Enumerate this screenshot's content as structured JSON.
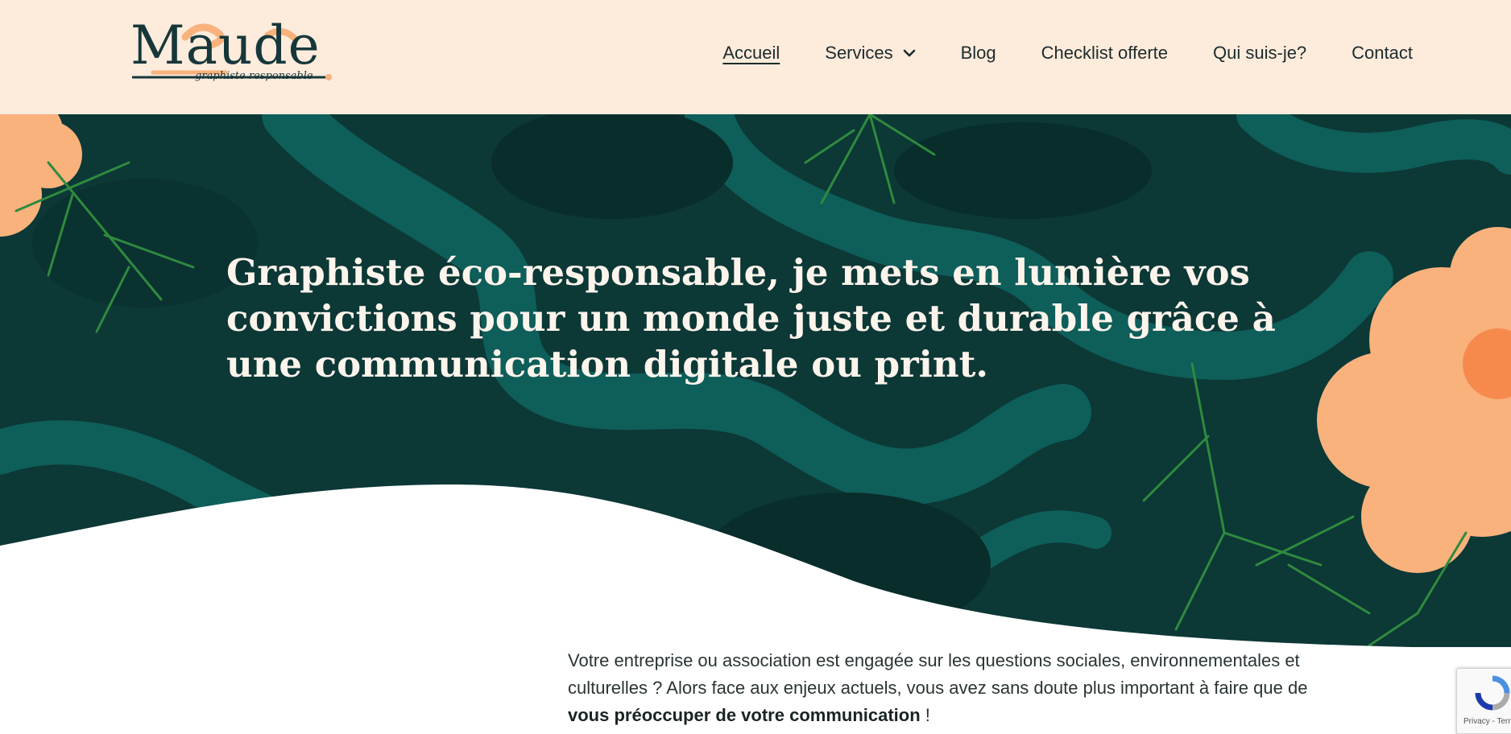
{
  "brand": {
    "name": "Maude",
    "tagline": "graphiste responsable"
  },
  "nav": {
    "items": [
      {
        "label": "Accueil",
        "active": true
      },
      {
        "label": "Services",
        "has_dropdown": true
      },
      {
        "label": "Blog"
      },
      {
        "label": "Checklist offerte"
      },
      {
        "label": "Qui suis-je?"
      },
      {
        "label": "Contact"
      }
    ]
  },
  "hero": {
    "title": "Graphiste éco-responsable, je mets en lumière vos convictions pour un monde juste et durable grâce à une communication digitale ou print."
  },
  "intro": {
    "text_before": "Votre entreprise ou association est engagée sur les questions sociales, environnementales et culturelles ? Alors face aux enjeux actuels, vous avez sans doute plus important à faire que de ",
    "text_bold": "vous préoccuper de votre communication",
    "text_after": " !"
  },
  "recaptcha": {
    "text": "Privacy - Terms"
  },
  "colors": {
    "header_bg": "#fdebdc",
    "hero_dark": "#0c3836",
    "hero_teal": "#0e5e5a",
    "flower_orange": "#f9b27c",
    "leaf_green": "#2f8a3e",
    "text_light": "#fdf4ec",
    "logo_ink": "#16373a"
  },
  "icons": [
    "chevron-down-icon",
    "recaptcha-icon"
  ]
}
